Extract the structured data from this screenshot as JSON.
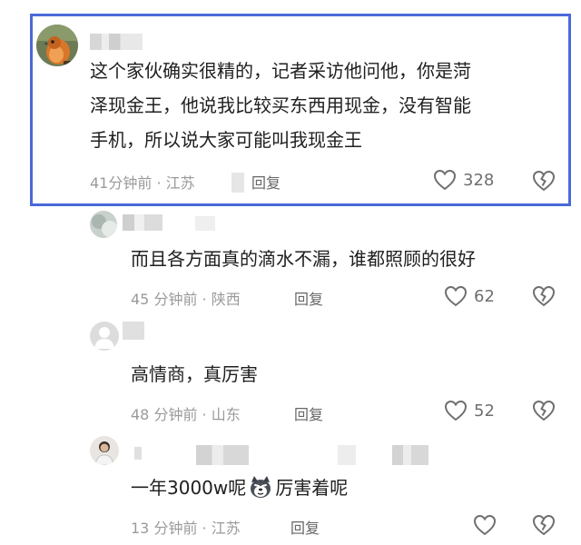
{
  "comments": [
    {
      "text_lines": [
        "这个家伙确实很精的，记者采访他问他，你是菏",
        "泽现金王，他说我比较买东西用现金，没有智能",
        "手机，所以说大家可能叫我现金王"
      ],
      "time_location": "41分钟前 · 江苏",
      "reply_label": "回复",
      "likes": "328"
    },
    {
      "text": "而且各方面真的滴水不漏，谁都照顾的很好",
      "time_location": "45 分钟前 · 陕西",
      "reply_label": "回复",
      "likes": "62"
    },
    {
      "text": "高情商，真厉害",
      "time_location": "48 分钟前 · 山东",
      "reply_label": "回复",
      "likes": "52"
    },
    {
      "text_before": "一年3000w呢",
      "text_after": "厉害着呢",
      "time_location": "13 分钟前 · 江苏",
      "reply_label": "回复",
      "likes": ""
    }
  ],
  "icons": {
    "like": "heart-outline-icon",
    "dislike": "broken-heart-icon",
    "emoji": "smirking-dog-emoji"
  },
  "colors": {
    "highlight_border": "#4a69d8",
    "meta_text": "#9a9a9a",
    "icon_stroke": "#6f6f6f"
  }
}
